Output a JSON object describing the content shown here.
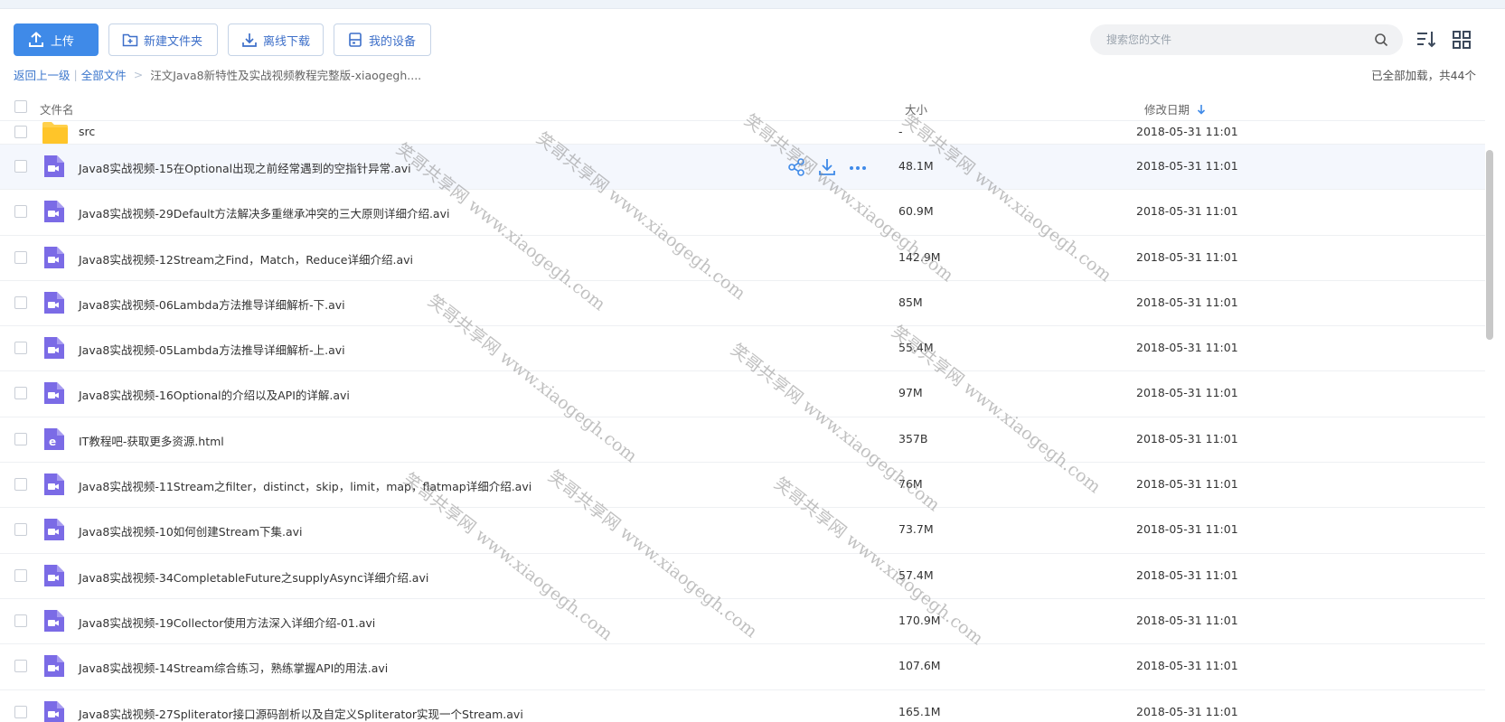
{
  "toolbar": {
    "upload_label": "上传",
    "new_folder_label": "新建文件夹",
    "offline_download_label": "离线下载",
    "my_devices_label": "我的设备"
  },
  "search": {
    "placeholder": "搜索您的文件"
  },
  "breadcrumb": {
    "back_label": "返回上一级",
    "divider": "|",
    "all_files_label": "全部文件",
    "arrow": ">",
    "current_folder": "汪文Java8新特性及实战视频教程完整版-xiaogegh...."
  },
  "load_status": "已全部加载，共44个",
  "table_header": {
    "name": "文件名",
    "size": "大小",
    "date": "修改日期"
  },
  "files": [
    {
      "name": "src",
      "size": "-",
      "date": "2018-05-31 11:01",
      "type": "folder"
    },
    {
      "name": "Java8实战视频-15在Optional出现之前经常遇到的空指针异常.avi",
      "size": "48.1M",
      "date": "2018-05-31 11:01",
      "type": "video"
    },
    {
      "name": "Java8实战视频-29Default方法解决多重继承冲突的三大原则详细介绍.avi",
      "size": "60.9M",
      "date": "2018-05-31 11:01",
      "type": "video"
    },
    {
      "name": "Java8实战视频-12Stream之Find，Match，Reduce详细介绍.avi",
      "size": "142.9M",
      "date": "2018-05-31 11:01",
      "type": "video"
    },
    {
      "name": "Java8实战视频-06Lambda方法推导详细解析-下.avi",
      "size": "85M",
      "date": "2018-05-31 11:01",
      "type": "video"
    },
    {
      "name": "Java8实战视频-05Lambda方法推导详细解析-上.avi",
      "size": "55.4M",
      "date": "2018-05-31 11:01",
      "type": "video"
    },
    {
      "name": "Java8实战视频-16Optional的介绍以及API的详解.avi",
      "size": "97M",
      "date": "2018-05-31 11:01",
      "type": "video"
    },
    {
      "name": "IT教程吧-获取更多资源.html",
      "size": "357B",
      "date": "2018-05-31 11:01",
      "type": "html"
    },
    {
      "name": "Java8实战视频-11Stream之filter，distinct，skip，limit，map，flatmap详细介绍.avi",
      "size": "76M",
      "date": "2018-05-31 11:01",
      "type": "video"
    },
    {
      "name": "Java8实战视频-10如何创建Stream下集.avi",
      "size": "73.7M",
      "date": "2018-05-31 11:01",
      "type": "video"
    },
    {
      "name": "Java8实战视频-34CompletableFuture之supplyAsync详细介绍.avi",
      "size": "57.4M",
      "date": "2018-05-31 11:01",
      "type": "video"
    },
    {
      "name": "Java8实战视频-19Collector使用方法深入详细介绍-01.avi",
      "size": "170.9M",
      "date": "2018-05-31 11:01",
      "type": "video"
    },
    {
      "name": "Java8实战视频-14Stream综合练习，熟练掌握API的用法.avi",
      "size": "107.6M",
      "date": "2018-05-31 11:01",
      "type": "video"
    },
    {
      "name": "Java8实战视频-27Spliterator接口源码剖析以及自定义Spliterator实现一个Stream.avi",
      "size": "165.1M",
      "date": "2018-05-31 11:01",
      "type": "video"
    }
  ],
  "watermark_text": "笑哥共享网 www.xiaogegh.com",
  "colors": {
    "accent": "#3f8ae8",
    "file_icon": "#7b6be6",
    "folder": "#ffd04b"
  }
}
